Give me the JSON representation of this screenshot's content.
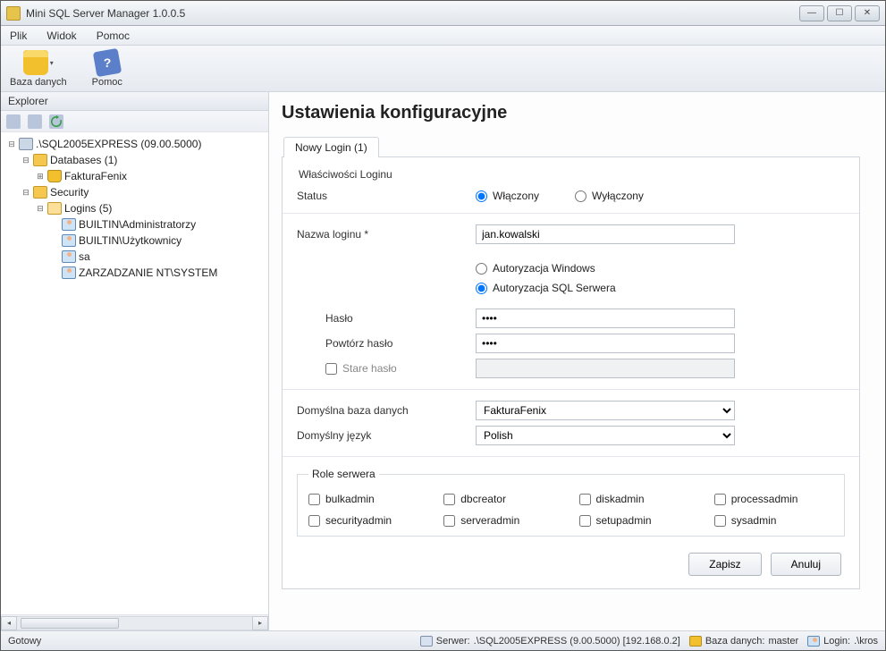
{
  "window": {
    "title": "Mini SQL Server Manager 1.0.0.5"
  },
  "menu": {
    "file": "Plik",
    "view": "Widok",
    "help": "Pomoc"
  },
  "toolbar": {
    "database": "Baza danych",
    "help": "Pomoc"
  },
  "explorer": {
    "title": "Explorer",
    "server": ".\\SQL2005EXPRESS (09.00.5000)",
    "databases_label": "Databases (1)",
    "db1": "FakturaFenix",
    "security_label": "Security",
    "logins_label": "Logins (5)",
    "logins": {
      "l0": "BUILTIN\\Administratorzy",
      "l1": "BUILTIN\\Użytkownicy",
      "l2": "sa",
      "l3": "ZARZADZANIE NT\\SYSTEM"
    }
  },
  "main": {
    "heading": "Ustawienia konfiguracyjne",
    "tab": "Nowy Login (1)",
    "group_label": "Właściwości Loginu",
    "status_label": "Status",
    "status_on": "Włączony",
    "status_off": "Wyłączony",
    "login_name_label": "Nazwa loginu *",
    "login_name_value": "jan.kowalski",
    "auth_win": "Autoryzacja Windows",
    "auth_sql": "Autoryzacja SQL Serwera",
    "password_label": "Hasło",
    "repeat_password_label": "Powtórz hasło",
    "old_password_label": "Stare hasło",
    "default_db_label": "Domyślna baza danych",
    "default_db_value": "FakturaFenix",
    "default_lang_label": "Domyślny język",
    "default_lang_value": "Polish",
    "roles_legend": "Role serwera",
    "roles": {
      "r0": "bulkadmin",
      "r1": "dbcreator",
      "r2": "diskadmin",
      "r3": "processadmin",
      "r4": "securityadmin",
      "r5": "serveradmin",
      "r6": "setupadmin",
      "r7": "sysadmin"
    },
    "save_btn": "Zapisz",
    "cancel_btn": "Anuluj"
  },
  "status": {
    "ready": "Gotowy",
    "server_label": "Serwer:",
    "server_value": ".\\SQL2005EXPRESS (9.00.5000) [192.168.0.2]",
    "db_label": "Baza danych:",
    "db_value": "master",
    "login_label": "Login:",
    "login_value": ".\\kros"
  }
}
